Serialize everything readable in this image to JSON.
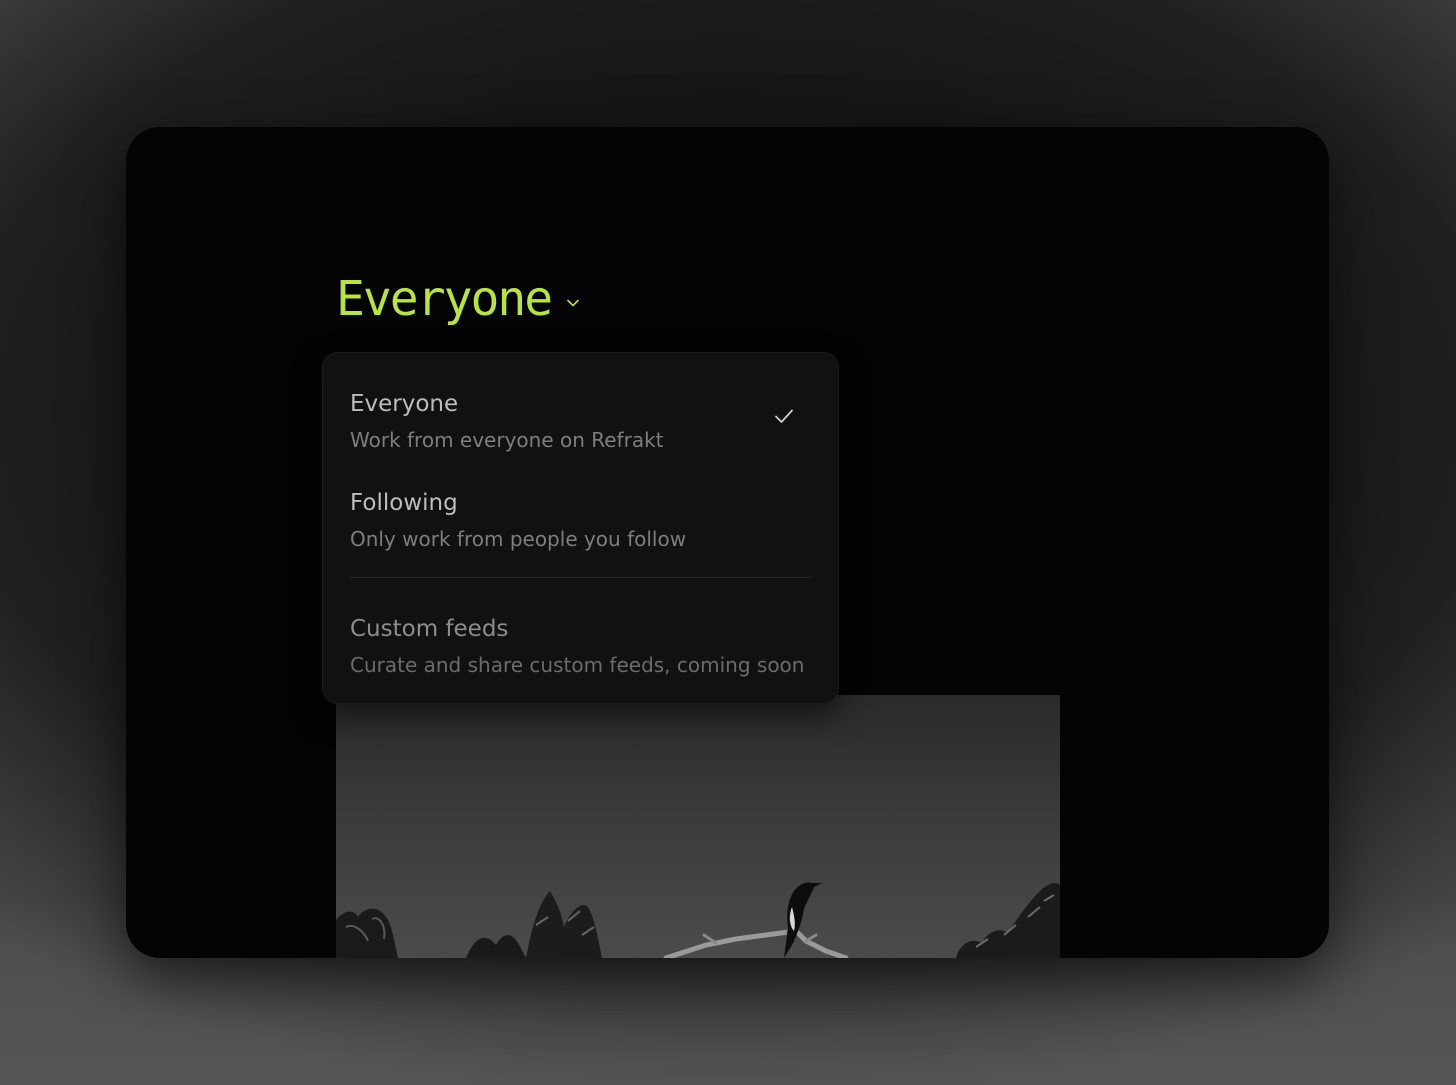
{
  "feed_selector": {
    "current": "Everyone",
    "accent_color": "#b7e43d",
    "icon": "chevron-down-icon"
  },
  "dropdown": {
    "options": [
      {
        "title": "Everyone",
        "description": "Work from everyone on Refrakt",
        "selected": true,
        "icon": "checkmark-icon"
      },
      {
        "title": "Following",
        "description": "Only work from people you follow",
        "selected": false
      }
    ],
    "custom": {
      "title": "Custom feeds",
      "description": "Curate and share custom feeds, coming soon",
      "disabled": true
    }
  }
}
